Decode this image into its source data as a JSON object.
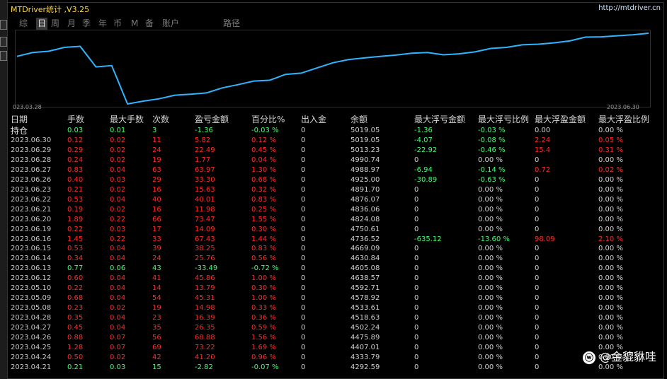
{
  "window": {
    "title": "MTDriver统计 ,V3.25",
    "url": "http://mtdriver.cn"
  },
  "tabs": [
    "综",
    "日",
    "周",
    "月",
    "季",
    "年",
    "币",
    "M",
    "备",
    "账户",
    "路径"
  ],
  "active_tab": "日",
  "chart_data": {
    "type": "line",
    "x_start": "023.03.28",
    "x_end": "2023.06.30",
    "color": "#2fb5ff",
    "values": [
      4160.0,
      4190.0,
      4200.0,
      4230.0,
      4238.0,
      4078.0,
      4088.0,
      3790.0,
      3812.0,
      3830.0,
      3858.0,
      3866.0,
      3876.0,
      3915.0,
      3940.0,
      3968.0,
      3974.0,
      4020.0,
      4030.0,
      4070.0,
      4110.0,
      4135.0,
      4148.0,
      4160.0,
      4170.0,
      4185.0,
      4190.0,
      4172.0,
      4180.0,
      4195.0,
      4222.0,
      4230.0,
      4250.0,
      4255.0,
      4265.0,
      4280.0,
      4310.0,
      4312.0,
      4320.0,
      4328.0,
      4340.0
    ]
  },
  "table": {
    "headers": [
      "日期",
      "手数",
      "最大手数",
      "次数",
      "盈亏金额",
      "百分比%",
      "出入金",
      "余额",
      "最大浮亏金额",
      "最大浮亏比例",
      "最大浮盈金额",
      "最大浮盈比例"
    ],
    "holding": {
      "label": "持仓",
      "lots": "0.03",
      "maxlots": "0.01",
      "count": "3",
      "pnl": "-1.36",
      "pct": "-0.03 %",
      "flow": "0",
      "balance": "5019.05",
      "floss": "-1.36",
      "flosspct": "-0.03 %",
      "fprofit": "0.00",
      "fprofitpct": "0.00 %"
    },
    "rows": [
      {
        "date": "2023.06.30",
        "lots": "0.12",
        "maxlots": "0.02",
        "count": "11",
        "pnl": "5.82",
        "pct": "0.12 %",
        "flow": "0",
        "balance": "5019.05",
        "floss": "-4.07",
        "flosspct": "-0.08 %",
        "fprofit": "2.24",
        "fprofitpct": "0.05 %"
      },
      {
        "date": "2023.06.29",
        "lots": "0.29",
        "maxlots": "0.02",
        "count": "24",
        "pnl": "22.49",
        "pct": "0.45 %",
        "flow": "0",
        "balance": "5013.23",
        "floss": "-22.92",
        "flosspct": "-0.46 %",
        "fprofit": "15.4",
        "fprofitpct": "0.31 %"
      },
      {
        "date": "2023.06.28",
        "lots": "0.24",
        "maxlots": "0.02",
        "count": "19",
        "pnl": "1.77",
        "pct": "0.04 %",
        "flow": "0",
        "balance": "4990.74",
        "floss": "0",
        "flosspct": "0.00 %",
        "fprofit": "0",
        "fprofitpct": "0.00 %"
      },
      {
        "date": "2023.06.27",
        "lots": "0.83",
        "maxlots": "0.04",
        "count": "63",
        "pnl": "63.97",
        "pct": "1.30 %",
        "flow": "0",
        "balance": "4988.97",
        "floss": "-6.94",
        "flosspct": "-0.14 %",
        "fprofit": "0.72",
        "fprofitpct": "0.02 %"
      },
      {
        "date": "2023.06.26",
        "lots": "0.40",
        "maxlots": "0.03",
        "count": "29",
        "pnl": "33.30",
        "pct": "0.68 %",
        "flow": "0",
        "balance": "4925.00",
        "floss": "-30.89",
        "flosspct": "-0.63 %",
        "fprofit": "0",
        "fprofitpct": "0.00 %"
      },
      {
        "date": "2023.06.23",
        "lots": "0.21",
        "maxlots": "0.02",
        "count": "16",
        "pnl": "15.63",
        "pct": "0.32 %",
        "flow": "0",
        "balance": "4891.70",
        "floss": "0",
        "flosspct": "0.00 %",
        "fprofit": "0",
        "fprofitpct": "0.00 %"
      },
      {
        "date": "2023.06.22",
        "lots": "0.53",
        "maxlots": "0.04",
        "count": "40",
        "pnl": "40.01",
        "pct": "0.83 %",
        "flow": "0",
        "balance": "4876.07",
        "floss": "0",
        "flosspct": "0.00 %",
        "fprofit": "0",
        "fprofitpct": "0.00 %"
      },
      {
        "date": "2023.06.21",
        "lots": "0.19",
        "maxlots": "0.02",
        "count": "16",
        "pnl": "11.98",
        "pct": "0.25 %",
        "flow": "0",
        "balance": "4836.06",
        "floss": "0",
        "flosspct": "0.00 %",
        "fprofit": "0",
        "fprofitpct": "0.00 %"
      },
      {
        "date": "2023.06.20",
        "lots": "1.89",
        "maxlots": "0.22",
        "count": "66",
        "pnl": "73.47",
        "pct": "1.55 %",
        "flow": "0",
        "balance": "4824.08",
        "floss": "0",
        "flosspct": "0.00 %",
        "fprofit": "0",
        "fprofitpct": "0.00 %"
      },
      {
        "date": "2023.06.19",
        "lots": "0.22",
        "maxlots": "0.03",
        "count": "17",
        "pnl": "14.09",
        "pct": "0.30 %",
        "flow": "0",
        "balance": "4750.61",
        "floss": "0",
        "flosspct": "0.00 %",
        "fprofit": "0",
        "fprofitpct": "0.00 %"
      },
      {
        "date": "2023.06.16",
        "lots": "1.45",
        "maxlots": "0.22",
        "count": "33",
        "pnl": "67.43",
        "pct": "1.44 %",
        "flow": "0",
        "balance": "4736.52",
        "floss": "-635.12",
        "flosspct": "-13.60 %",
        "fprofit": "98.09",
        "fprofitpct": "2.10 %"
      },
      {
        "date": "2023.06.15",
        "lots": "0.53",
        "maxlots": "0.04",
        "count": "39",
        "pnl": "38.25",
        "pct": "0.83 %",
        "flow": "0",
        "balance": "4669.09",
        "floss": "0",
        "flosspct": "0.00 %",
        "fprofit": "0",
        "fprofitpct": "0.00 %"
      },
      {
        "date": "2023.06.14",
        "lots": "0.34",
        "maxlots": "0.04",
        "count": "24",
        "pnl": "25.76",
        "pct": "0.56 %",
        "flow": "0",
        "balance": "4630.84",
        "floss": "0",
        "flosspct": "0.00 %",
        "fprofit": "0",
        "fprofitpct": "0.00 %"
      },
      {
        "date": "2023.06.13",
        "lots": "0.77",
        "maxlots": "0.06",
        "count": "43",
        "pnl": "-33.49",
        "pct": "-0.72 %",
        "flow": "0",
        "balance": "4605.08",
        "floss": "0",
        "flosspct": "0.00 %",
        "fprofit": "0",
        "fprofitpct": "0.00 %"
      },
      {
        "date": "2023.06.12",
        "lots": "0.60",
        "maxlots": "0.04",
        "count": "41",
        "pnl": "45.86",
        "pct": "1.00 %",
        "flow": "0",
        "balance": "4638.57",
        "floss": "0",
        "flosspct": "0.00 %",
        "fprofit": "0",
        "fprofitpct": "0.00 %"
      },
      {
        "date": "2023.05.10",
        "lots": "0.22",
        "maxlots": "0.04",
        "count": "14",
        "pnl": "13.79",
        "pct": "0.30 %",
        "flow": "0",
        "balance": "4592.71",
        "floss": "0",
        "flosspct": "0.00 %",
        "fprofit": "0",
        "fprofitpct": "0.00 %"
      },
      {
        "date": "2023.05.09",
        "lots": "0.68",
        "maxlots": "0.04",
        "count": "54",
        "pnl": "45.31",
        "pct": "1.00 %",
        "flow": "0",
        "balance": "4578.92",
        "floss": "0",
        "flosspct": "0.00 %",
        "fprofit": "0",
        "fprofitpct": "0.00 %"
      },
      {
        "date": "2023.05.08",
        "lots": "0.23",
        "maxlots": "0.02",
        "count": "19",
        "pnl": "14.98",
        "pct": "0.33 %",
        "flow": "0",
        "balance": "4533.61",
        "floss": "0",
        "flosspct": "0.00 %",
        "fprofit": "0",
        "fprofitpct": "0.00 %"
      },
      {
        "date": "2023.04.28",
        "lots": "0.35",
        "maxlots": "0.04",
        "count": "23",
        "pnl": "16.39",
        "pct": "0.36 %",
        "flow": "0",
        "balance": "4518.63",
        "floss": "0",
        "flosspct": "0.00 %",
        "fprofit": "0",
        "fprofitpct": "0.00 %"
      },
      {
        "date": "2023.04.27",
        "lots": "0.45",
        "maxlots": "0.04",
        "count": "35",
        "pnl": "26.35",
        "pct": "0.59 %",
        "flow": "0",
        "balance": "4502.24",
        "floss": "0",
        "flosspct": "0.00 %",
        "fprofit": "0",
        "fprofitpct": "0.00 %"
      },
      {
        "date": "2023.04.26",
        "lots": "0.88",
        "maxlots": "0.07",
        "count": "56",
        "pnl": "68.88",
        "pct": "1.56 %",
        "flow": "0",
        "balance": "4475.89",
        "floss": "0",
        "flosspct": "0.00 %",
        "fprofit": "0",
        "fprofitpct": "0.00 %"
      },
      {
        "date": "2023.04.25",
        "lots": "1.28",
        "maxlots": "0.07",
        "count": "69",
        "pnl": "73.22",
        "pct": "1.69 %",
        "flow": "0",
        "balance": "4407.01",
        "floss": "0",
        "flosspct": "0.00 %",
        "fprofit": "0",
        "fprofitpct": "0.00 %"
      },
      {
        "date": "2023.04.24",
        "lots": "0.50",
        "maxlots": "0.02",
        "count": "42",
        "pnl": "41.20",
        "pct": "0.96 %",
        "flow": "0",
        "balance": "4333.79",
        "floss": "0",
        "flosspct": "0.00 %",
        "fprofit": "0",
        "fprofitpct": "0.00 %"
      },
      {
        "date": "2023.04.21",
        "lots": "0.21",
        "maxlots": "0.03",
        "count": "15",
        "pnl": "-2.82",
        "pct": "-0.07 %",
        "flow": "0",
        "balance": "4292.59",
        "floss": "0",
        "flosspct": "0.00 %",
        "fprofit": "0",
        "fprofitpct": "0.00 %"
      }
    ]
  },
  "watermark": {
    "icon": "weibo-icon",
    "text": "@金貔貅哇"
  },
  "colors": {
    "positive": "#40ff70",
    "negative": "#ff2a2a",
    "title": "#ffd84a",
    "line": "#2fb5ff"
  }
}
